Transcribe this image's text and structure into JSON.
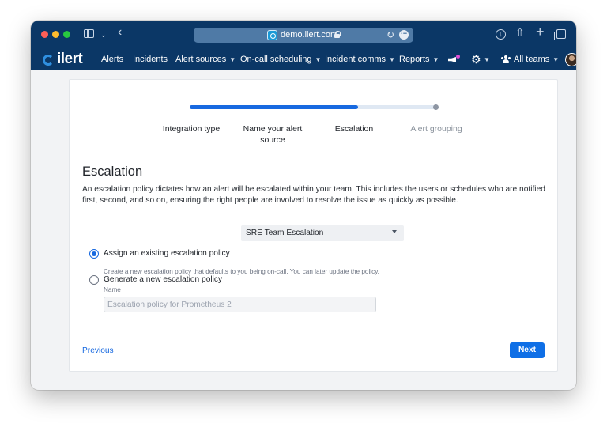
{
  "browser": {
    "url": "demo.ilert.com"
  },
  "navbar": {
    "logo": "ilert",
    "items": [
      {
        "label": "Alerts",
        "has_dropdown": false
      },
      {
        "label": "Incidents",
        "has_dropdown": false
      },
      {
        "label": "Alert sources",
        "has_dropdown": true
      },
      {
        "label": "On-call scheduling",
        "has_dropdown": true
      },
      {
        "label": "Incident comms",
        "has_dropdown": true
      },
      {
        "label": "Reports",
        "has_dropdown": true
      }
    ],
    "teams_label": "All teams"
  },
  "wizard": {
    "progress": 0.68,
    "steps": [
      {
        "label": "Integration type",
        "state": "done"
      },
      {
        "label": "Name your alert source",
        "state": "done"
      },
      {
        "label": "Escalation",
        "state": "active"
      },
      {
        "label": "Alert grouping",
        "state": "inactive"
      }
    ]
  },
  "escalation": {
    "title": "Escalation",
    "description": "An escalation policy dictates how an alert will be escalated within your team. This includes the users or schedules who are notified first, second, and so on, ensuring the right people are involved to resolve the issue as quickly as possible.",
    "option_existing": {
      "label": "Assign an existing escalation policy",
      "checked": true,
      "selected_policy": "SRE Team Escalation"
    },
    "option_new": {
      "label": "Generate a new escalation policy",
      "checked": false,
      "helper": "Create a new escalation policy that defaults to you being on-call. You can later update the policy.",
      "name_label": "Name",
      "name_placeholder": "Escalation policy for Prometheus 2"
    }
  },
  "footer": {
    "previous_label": "Previous",
    "next_label": "Next"
  },
  "colors": {
    "nav_background": "#0b3766",
    "accent": "#1769e0",
    "progress_track": "#dfe8f3"
  }
}
